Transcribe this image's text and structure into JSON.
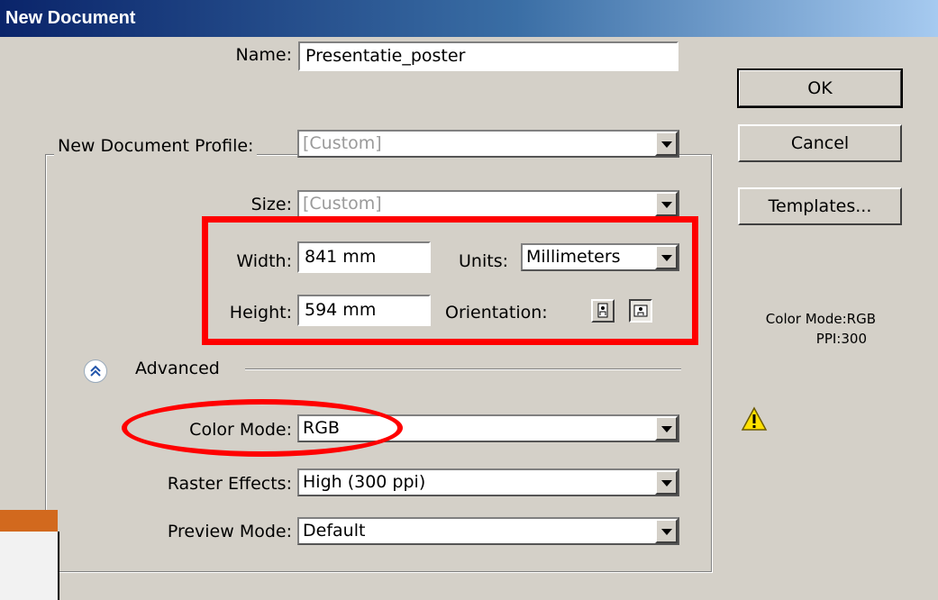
{
  "window": {
    "title": "New Document"
  },
  "form": {
    "name_label": "Name:",
    "name_value": "Presentatie_poster",
    "profile_label": "New Document Profile:",
    "profile_value": "[Custom]",
    "size_label": "Size:",
    "size_value": "[Custom]",
    "width_label": "Width:",
    "width_value": "841 mm",
    "height_label": "Height:",
    "height_value": "594 mm",
    "units_label": "Units:",
    "units_value": "Millimeters",
    "orientation_label": "Orientation:",
    "advanced_label": "Advanced",
    "color_mode_label": "Color Mode:",
    "color_mode_value": "RGB",
    "raster_label": "Raster Effects:",
    "raster_value": "High (300 ppi)",
    "preview_label": "Preview Mode:",
    "preview_value": "Default"
  },
  "buttons": {
    "ok": "OK",
    "cancel": "Cancel",
    "templates": "Templates..."
  },
  "info": {
    "color_mode": "Color Mode:RGB",
    "ppi": "PPI:300"
  },
  "icons": {
    "advanced": "collapse-chevrons-icon",
    "warning": "warning-triangle-icon",
    "portrait": "portrait-orientation-icon",
    "landscape": "landscape-orientation-icon"
  },
  "colors": {
    "annotation": "#ff0000",
    "title_bar": "#0a246a",
    "dialog_bg": "#d4d0c8"
  }
}
